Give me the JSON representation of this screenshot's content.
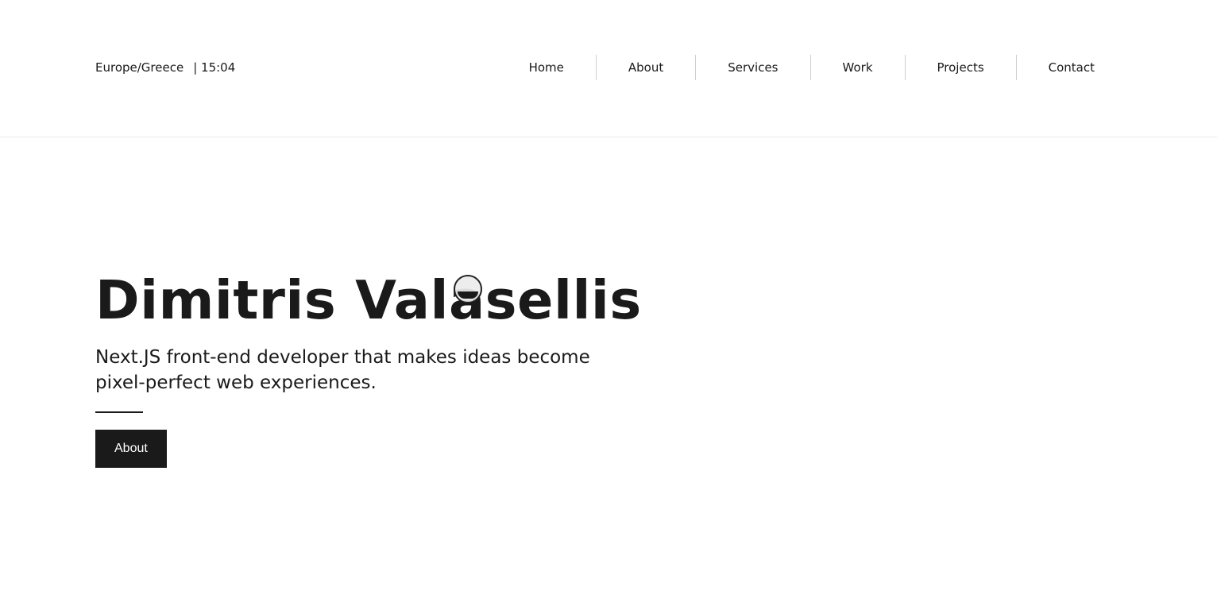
{
  "header": {
    "timezone": "Europe/Greece",
    "time": "| 15:04"
  },
  "nav": {
    "items": [
      {
        "label": "Home"
      },
      {
        "label": "About"
      },
      {
        "label": "Services"
      },
      {
        "label": "Work"
      },
      {
        "label": "Projects"
      },
      {
        "label": "Contact"
      }
    ]
  },
  "hero": {
    "title": "Dimitris Valasellis",
    "subtitle": "Next.JS front-end developer that makes ideas become pixel-perfect web experiences.",
    "cta_label": "About"
  },
  "colors": {
    "text": "#1a1a1a",
    "background": "#ffffff",
    "button_bg": "#1a1a1a",
    "button_text": "#ffffff",
    "separator": "#cfcfcf"
  },
  "icons": {
    "cursor": "custom-cursor-circle-icon"
  }
}
